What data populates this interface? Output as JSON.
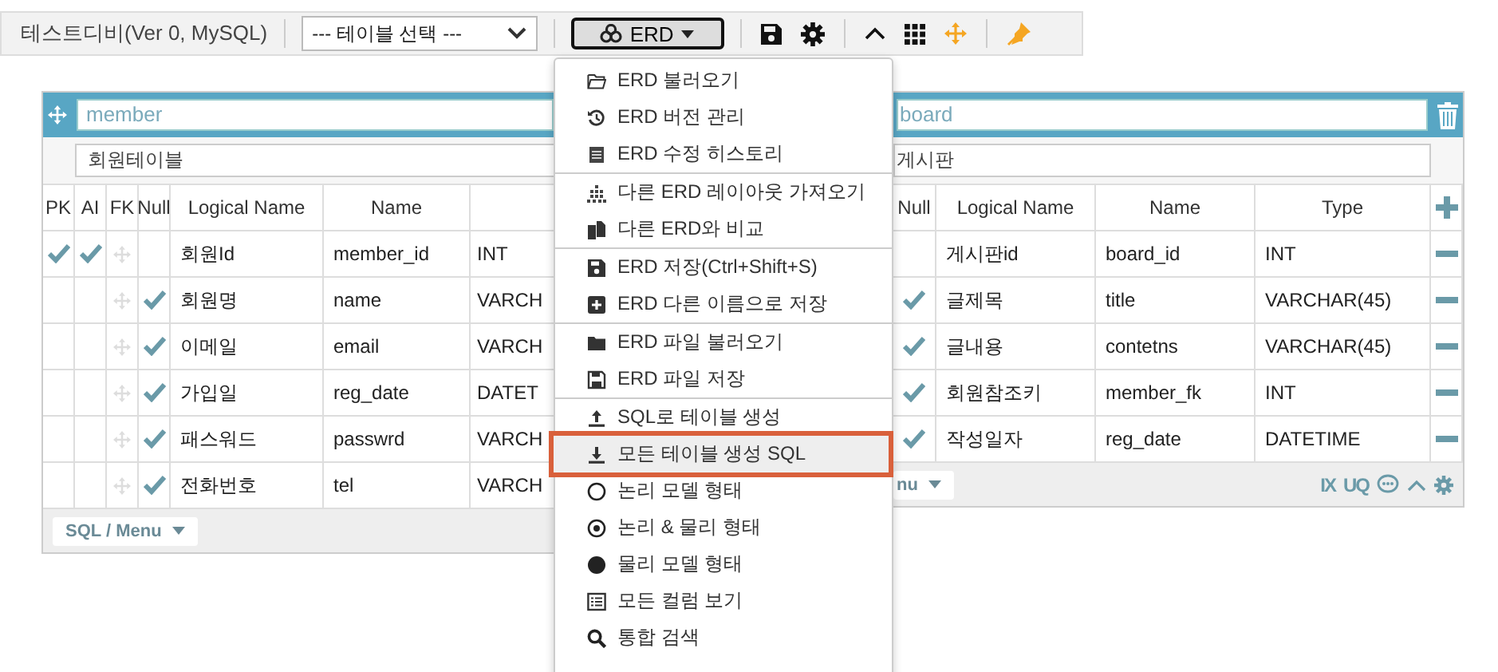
{
  "toolbar": {
    "title": "테스트디비(Ver 0, MySQL)",
    "table_select": {
      "value": "--- 테이블 선택 ---"
    },
    "erd_button": {
      "label": "ERD",
      "expanded": true
    }
  },
  "member_table": {
    "name": "member",
    "comment": "회원테이블",
    "headers": [
      "PK",
      "AI",
      "FK",
      "Null",
      "Logical Name",
      "Name"
    ],
    "rows": [
      {
        "pk": true,
        "ai": true,
        "nullable": false,
        "logical": "회원Id",
        "name": "member_id",
        "type": "INT"
      },
      {
        "pk": false,
        "ai": false,
        "nullable": true,
        "logical": "회원명",
        "name": "name",
        "type": "VARCH"
      },
      {
        "pk": false,
        "ai": false,
        "nullable": true,
        "logical": "이메일",
        "name": "email",
        "type": "VARCH"
      },
      {
        "pk": false,
        "ai": false,
        "nullable": true,
        "logical": "가입일",
        "name": "reg_date",
        "type": "DATET"
      },
      {
        "pk": false,
        "ai": false,
        "nullable": true,
        "logical": "패스워드",
        "name": "passwrd",
        "type": "VARCH"
      },
      {
        "pk": false,
        "ai": false,
        "nullable": true,
        "logical": "전화번호",
        "name": "tel",
        "type": "VARCH"
      }
    ],
    "footer_button": "SQL / Menu"
  },
  "board_table": {
    "name": "board",
    "comment": "게시판",
    "headers": [
      "Null",
      "Logical Name",
      "Name",
      "Type"
    ],
    "rows": [
      {
        "nullable": false,
        "logical": "게시판id",
        "name": "board_id",
        "type": "INT"
      },
      {
        "nullable": true,
        "logical": "글제목",
        "name": "title",
        "type": "VARCHAR(45)"
      },
      {
        "nullable": true,
        "logical": "글내용",
        "name": "contetns",
        "type": "VARCHAR(45)"
      },
      {
        "nullable": true,
        "logical": "회원참조키",
        "name": "member_fk",
        "type": "INT"
      },
      {
        "nullable": true,
        "logical": "작성일자",
        "name": "reg_date",
        "type": "DATETIME"
      }
    ],
    "footer_button": "nu",
    "footer_labels": [
      "IX",
      "UQ"
    ]
  },
  "menu": {
    "groups": [
      [
        {
          "label": "ERD 불러오기",
          "selected": false
        },
        {
          "label": "ERD 버전 관리",
          "selected": false
        },
        {
          "label": "ERD 수정 히스토리",
          "selected": false
        }
      ],
      [
        {
          "label": "다른 ERD 레이아웃 가져오기",
          "selected": false
        },
        {
          "label": "다른 ERD와 비교",
          "selected": false
        }
      ],
      [
        {
          "label": "ERD 저장(Ctrl+Shift+S)",
          "selected": false
        },
        {
          "label": "ERD 다른 이름으로 저장",
          "selected": false
        }
      ],
      [
        {
          "label": "ERD 파일 불러오기",
          "selected": false
        },
        {
          "label": "ERD 파일 저장",
          "selected": false
        }
      ],
      [
        {
          "label": "SQL로 테이블 생성",
          "selected": false
        },
        {
          "label": "모든 테이블 생성 SQL",
          "selected": true
        },
        {
          "label": "논리 모델 형태",
          "selected": false
        },
        {
          "label": "논리 & 물리 형태",
          "selected": false
        },
        {
          "label": "물리 모델 형태",
          "selected": false
        },
        {
          "label": "모든 컬럼 보기",
          "selected": false
        },
        {
          "label": "통합 검색",
          "selected": false
        }
      ]
    ]
  }
}
